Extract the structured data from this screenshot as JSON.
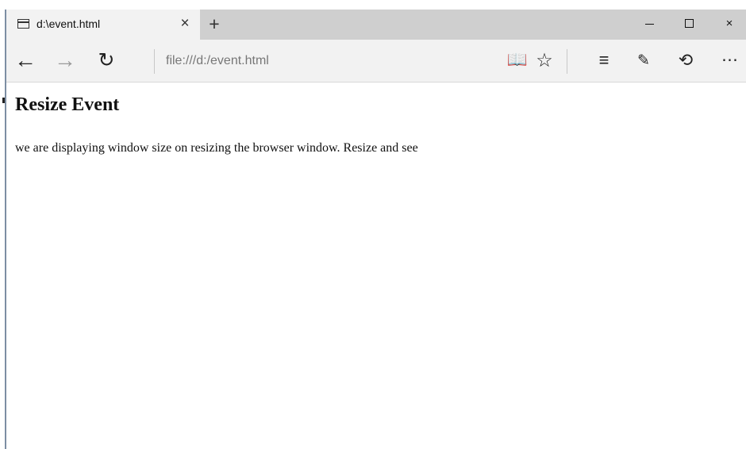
{
  "window": {
    "tab_title": "d:\\event.html",
    "tab_close": "×",
    "new_tab": "+",
    "minimize": "–",
    "maximize": "□",
    "close": "×"
  },
  "toolbar": {
    "back_icon": "←",
    "forward_icon": "→",
    "refresh_icon": "↻",
    "address": "file:///d:/event.html",
    "reading_view_icon": "📖",
    "favorite_icon": "☆",
    "hub_icon": "≡",
    "note_icon": "✎",
    "share_icon": "⟲",
    "more_icon": "⋯"
  },
  "page": {
    "title": "Resize Event",
    "text": "we are displaying window size on resizing the browser window. Resize and see"
  }
}
